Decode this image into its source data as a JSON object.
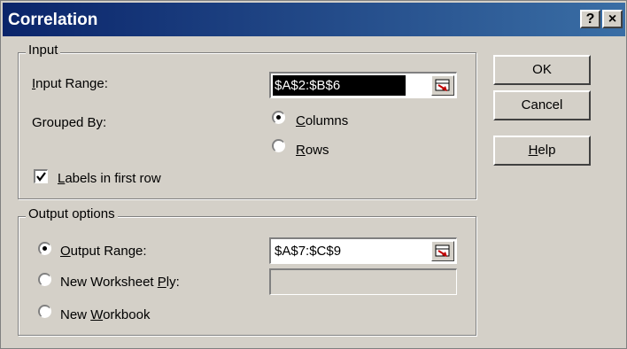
{
  "window": {
    "title": "Correlation",
    "help_glyph": "?",
    "close_glyph": "×"
  },
  "input_group": {
    "legend": "Input",
    "input_range_label": "Input Range:",
    "input_range_value": "$A$2:$B$6",
    "grouped_by_label": "Grouped By:",
    "columns_label": "Columns",
    "rows_label": "Rows",
    "grouped_by_selected": "Columns",
    "labels_checkbox_label": "Labels in first row",
    "labels_checked": true
  },
  "output_group": {
    "legend": "Output options",
    "output_range_label": "Output Range:",
    "output_range_value": "$A$7:$C$9",
    "new_worksheet_label": "New Worksheet Ply:",
    "new_worksheet_value": "",
    "new_workbook_label": "New Workbook",
    "selected": "Output Range"
  },
  "buttons": {
    "ok": "OK",
    "cancel": "Cancel",
    "help": "Help"
  },
  "icons": [
    "range-picker-icon",
    "help-icon",
    "close-icon",
    "checkmark-icon"
  ]
}
